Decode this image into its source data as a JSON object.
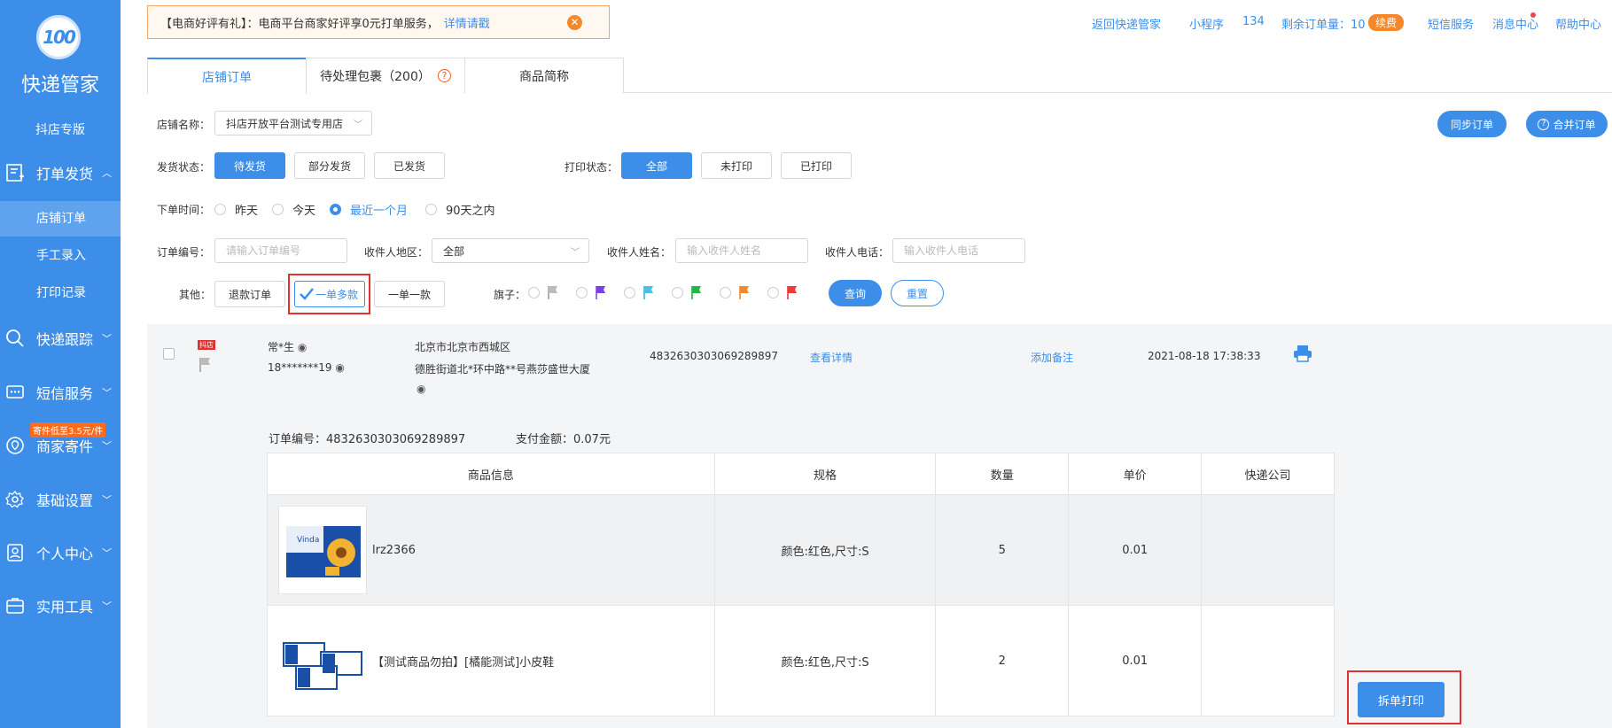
{
  "sidebar": {
    "logo_text": "100",
    "brand": "快递管家",
    "douyin": "抖店专版",
    "groups": {
      "print": "打单发货",
      "track": "快递跟踪",
      "sms": "短信服务",
      "send": "商家寄件",
      "basic": "基础设置",
      "personal": "个人中心",
      "tools": "实用工具"
    },
    "send_badge": "寄件低至3.5元/件",
    "items": {
      "shop_orders": "店铺订单",
      "manual": "手工录入",
      "print_log": "打印记录"
    }
  },
  "notice": {
    "title": "【电商好评有礼】：电商平台商家好评享0元打单服务，",
    "link": "详情请戳",
    "close": "✕"
  },
  "topbar": {
    "back": "返回快递管家",
    "mini": "小程序",
    "num": "134",
    "remaining": "剩余订单量：10",
    "renew": "续费",
    "sms": "短信服务",
    "msg": "消息中心",
    "help": "帮助中心"
  },
  "tabs": {
    "shop_orders": "店铺订单",
    "pending": "待处理包裹（200）",
    "product_abbr": "商品简称"
  },
  "filters": {
    "shop_label": "店铺名称：",
    "shop_value": "抖店开放平台测试专用店",
    "sync": "同步订单",
    "merge": "合并订单",
    "ship_label": "发货状态：",
    "ship": [
      "待发货",
      "部分发货",
      "已发货"
    ],
    "print_label": "打印状态：",
    "print": [
      "全部",
      "未打印",
      "已打印"
    ],
    "time_label": "下单时间：",
    "time": [
      "昨天",
      "今天",
      "最近一个月",
      "90天之内"
    ],
    "order_no_label": "订单编号：",
    "order_no_placeholder": "请输入订单编号",
    "region_label": "收件人地区：",
    "region_value": "全部",
    "name_label": "收件人姓名：",
    "name_placeholder": "输入收件人姓名",
    "phone_label": "收件人电话：",
    "phone_placeholder": "输入收件人电话",
    "other_label": "其他：",
    "other": [
      "退款订单",
      "一单多款",
      "一单一款"
    ],
    "flag_label": "旗子：",
    "query": "查询",
    "reset": "重置"
  },
  "order": {
    "tag": "抖店",
    "name": "常*生",
    "phone": "18*******19",
    "addr1": "北京市北京市西城区",
    "addr2": "德胜街道北*环中路**号燕莎盛世大厦",
    "order_no": "4832630303069289897",
    "detail": "查看详情",
    "note": "添加备注",
    "time": "2021-08-18 17:38:33",
    "sub_order_label": "订单编号：4832630303069289897",
    "pay_label": "支付金额：0.07元",
    "split_print": "拆单打印"
  },
  "table": {
    "headers": [
      "商品信息",
      "规格",
      "数量",
      "单价",
      "快递公司"
    ],
    "rows": [
      {
        "name": "lrz2366",
        "spec": "颜色:红色,尺寸:S",
        "qty": "5",
        "price": "0.01",
        "express": ""
      },
      {
        "name": "【测试商品勿拍】[橘能测试]小皮鞋",
        "spec": "颜色:红色,尺寸:S",
        "qty": "2",
        "price": "0.01",
        "express": ""
      }
    ]
  },
  "colors": {
    "primary": "#3d8ee8",
    "sidebar": "#3d8ee8",
    "highlight_box": "#e03131",
    "renew": "#f5882a"
  }
}
